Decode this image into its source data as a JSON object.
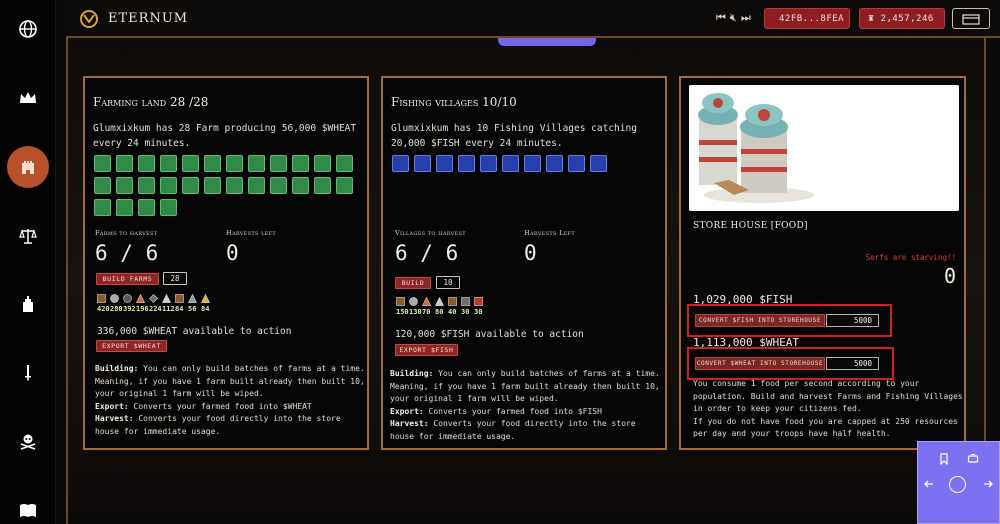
{
  "app": {
    "title": "ETERNUM"
  },
  "sidebar": {
    "items": [
      {
        "icon": "globe-icon"
      },
      {
        "icon": "crown-icon"
      },
      {
        "icon": "castle-icon",
        "active": true
      },
      {
        "icon": "scales-icon"
      },
      {
        "icon": "fortress-icon"
      },
      {
        "icon": "sword-icon"
      },
      {
        "icon": "skull-crossbones-icon"
      },
      {
        "icon": "book-icon"
      }
    ]
  },
  "topbar": {
    "address": "42FB...8FEA",
    "balance": "2,457,246"
  },
  "farming": {
    "title": "Farming land 28 /28",
    "description": "Glumxixkum has 28 Farm producing 56,000 $WHEAT every 24 minutes.",
    "farm_count": 28,
    "harvest_label": "Farms to harvest",
    "harvest_value": "6 / 6",
    "left_label": "Harvests left",
    "left_value": "0",
    "build_label": "BUILD FARMS",
    "build_qty": "28",
    "resources": [
      {
        "color": "#8a5a2b",
        "shape": "square",
        "value": "420"
      },
      {
        "color": "#a9a9a9",
        "shape": "circle",
        "value": "280"
      },
      {
        "color": "#5c5c5c",
        "shape": "circle",
        "value": "392"
      },
      {
        "color": "#d46a3a",
        "shape": "triangle",
        "value": "196"
      },
      {
        "color": "#6e6e6e",
        "shape": "diamond",
        "value": "224"
      },
      {
        "color": "#cfcfcf",
        "shape": "triangle",
        "value": "112"
      },
      {
        "color": "#8a5a2b",
        "shape": "square",
        "value": "84"
      },
      {
        "color": "#7fa1b8",
        "shape": "triangle",
        "value": "56"
      },
      {
        "color": "#e0b62e",
        "shape": "triangle",
        "value": "84"
      }
    ],
    "available": "336,000 $WHEAT available to action",
    "export_label": "EXPORT $WHEAT",
    "help": {
      "building_label": "Building:",
      "building_text": " You can only build batches of farms at a time. Meaning, if you have 1 farm built already then built 10, your original 1 farm will be wiped.",
      "export_label": "Export:",
      "export_text": " Converts your farmed food into $WHEAT",
      "harvest_label": "Harvest:",
      "harvest_text": " Converts your food directly into the store house for immediate usage."
    }
  },
  "fishing": {
    "title": "Fishing villages 10/10",
    "description": "Glumxixkum has 10 Fishing Villages catching 20,000 $FISH every 24 minutes.",
    "village_count": 10,
    "harvest_label": "Villages to harvest",
    "harvest_value": "6 / 6",
    "left_label": "Harvests Left",
    "left_value": "0",
    "build_label": "BUILD",
    "build_qty": "10",
    "resources": [
      {
        "color": "#8a5a2b",
        "shape": "square",
        "value": "150"
      },
      {
        "color": "#a9a9a9",
        "shape": "circle",
        "value": "130"
      },
      {
        "color": "#d46a3a",
        "shape": "triangle",
        "value": "70"
      },
      {
        "color": "#cfcfcf",
        "shape": "triangle",
        "value": "80"
      },
      {
        "color": "#8a5a2b",
        "shape": "square",
        "value": "40"
      },
      {
        "color": "#6e6e6e",
        "shape": "square",
        "value": "30"
      },
      {
        "color": "#c0392b",
        "shape": "square",
        "value": "30"
      }
    ],
    "available": "120,000 $FISH available to action",
    "export_label": "EXPORT $FISH",
    "help": {
      "building_label": "Building:",
      "building_text": " You can only build batches of farms at a time. Meaning, if you have 1 farm built already then built 10, your original 1 farm will be wiped.",
      "export_label": "Export:",
      "export_text": " Converts your farmed food into $FISH",
      "harvest_label": "Harvest:",
      "harvest_text": " Converts your food directly into the store house for immediate usage."
    }
  },
  "storehouse": {
    "title": "STORE HOUSE [FOOD]",
    "starving": "Serfs are starving!!",
    "food_value": "0",
    "fish_amount": "1,029,000 $FISH",
    "fish_convert_label": "CONVERT $FISH INTO STOREHOUSE",
    "fish_convert_value": "5000",
    "wheat_amount": "1,113,000 $WHEAT",
    "wheat_convert_label": "CONVERT $WHEAT INTO STOREHOUSE",
    "wheat_convert_value": "5000",
    "info": "You consume 1 food per second according to your population. Build and harvest Farms and Fishing Villages in order to keep your citizens fed.",
    "info2": "If you do not have food you are capped at 250 resources per day and your troops have half health."
  },
  "colors": {
    "accent_border": "#a36a37",
    "button_red": "#8f2626",
    "farm_green": "#2f8b46",
    "fish_blue": "#2540ad",
    "widget_purple": "#7d71f2",
    "highlight_red": "#d31f1f"
  }
}
